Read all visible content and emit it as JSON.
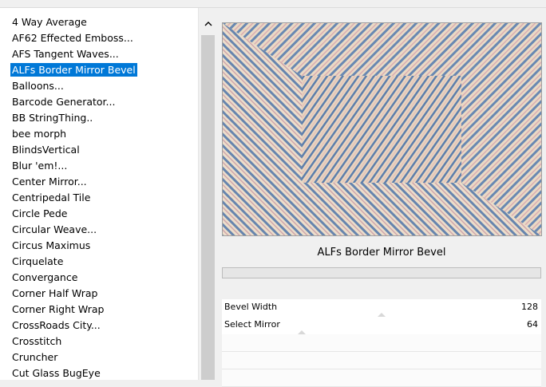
{
  "filter_list": {
    "items": [
      {
        "label": "4 Way Average",
        "selected": false
      },
      {
        "label": "AF62 Effected Emboss...",
        "selected": false
      },
      {
        "label": "AFS Tangent Waves...",
        "selected": false
      },
      {
        "label": "ALFs Border Mirror Bevel",
        "selected": true
      },
      {
        "label": "Balloons...",
        "selected": false
      },
      {
        "label": "Barcode Generator...",
        "selected": false
      },
      {
        "label": "BB StringThing..",
        "selected": false
      },
      {
        "label": "bee morph",
        "selected": false
      },
      {
        "label": "BlindsVertical",
        "selected": false
      },
      {
        "label": "Blur 'em!...",
        "selected": false
      },
      {
        "label": "Center Mirror...",
        "selected": false
      },
      {
        "label": "Centripedal Tile",
        "selected": false
      },
      {
        "label": "Circle Pede",
        "selected": false
      },
      {
        "label": "Circular Weave...",
        "selected": false
      },
      {
        "label": "Circus Maximus",
        "selected": false
      },
      {
        "label": "Cirquelate",
        "selected": false
      },
      {
        "label": "Convergance",
        "selected": false
      },
      {
        "label": "Corner Half Wrap",
        "selected": false
      },
      {
        "label": "Corner Right Wrap",
        "selected": false
      },
      {
        "label": "CrossRoads City...",
        "selected": false
      },
      {
        "label": "Crosstitch",
        "selected": false
      },
      {
        "label": "Cruncher",
        "selected": false
      },
      {
        "label": "Cut Glass  BugEye",
        "selected": false
      }
    ],
    "scroll_up_icon": "chevron-up-icon"
  },
  "filter_title": "ALFs Border Mirror Bevel",
  "progress": 0,
  "parameters": [
    {
      "label": "Bevel Width",
      "value": "128",
      "fraction": 0.5
    },
    {
      "label": "Select Mirror",
      "value": "64",
      "fraction": 0.25
    }
  ],
  "colors": {
    "selection": "#0078d7",
    "preview_blue": "#3e6aa6",
    "preview_pink": "#d49aa4",
    "preview_cream": "#eadbc6"
  }
}
